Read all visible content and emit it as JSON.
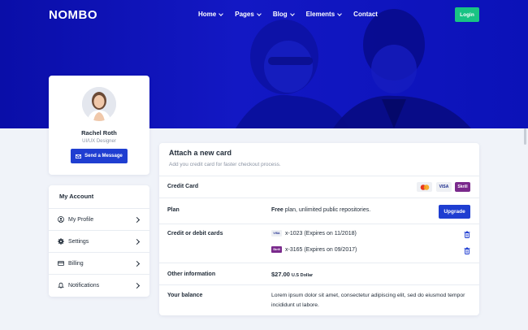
{
  "nav": {
    "logo": "NOMBO",
    "items": [
      {
        "label": "Home",
        "dropdown": true
      },
      {
        "label": "Pages",
        "dropdown": true
      },
      {
        "label": "Blog",
        "dropdown": true
      },
      {
        "label": "Elements",
        "dropdown": true
      },
      {
        "label": "Contact",
        "dropdown": false
      }
    ],
    "login_label": "Login"
  },
  "profile": {
    "name": "Rachel Roth",
    "role": "UI/UX Designer",
    "send_label": "Send a Message"
  },
  "account": {
    "title": "My Account",
    "items": [
      {
        "label": "My Profile",
        "icon": "user-icon"
      },
      {
        "label": "Settings",
        "icon": "gear-icon"
      },
      {
        "label": "Billing",
        "icon": "credit-card-icon"
      },
      {
        "label": "Notifications",
        "icon": "bell-icon"
      }
    ]
  },
  "card": {
    "title": "Attach a new card",
    "subtitle": "Add you credit card for faster checkout process.",
    "credit_card_label": "Credit Card",
    "brands": [
      "mastercard",
      "VISA",
      "Skrill"
    ],
    "plan_label": "Plan",
    "plan_bold": "Free",
    "plan_rest": " plan, unlimited public repositories.",
    "upgrade_label": "Upgrade",
    "cards_label": "Credit or debit cards",
    "cards": [
      {
        "brand": "VISA",
        "text": "x-1023 (Expires on 11/2018)"
      },
      {
        "brand": "Skrill",
        "text": "x-3165 (Expires on 09/2017)"
      }
    ],
    "other_label": "Other information",
    "other_amount": "$27.00",
    "other_currency": "U.S Dollar",
    "balance_label": "Your balance",
    "balance_text": "Lorem ipsum dolor sit amet, consectetur adipiscing elit, sed do eiusmod tempor incididunt ut labore."
  },
  "colors": {
    "hero": "#1318c4",
    "primary": "#1f3ed1",
    "login": "#19c384"
  }
}
